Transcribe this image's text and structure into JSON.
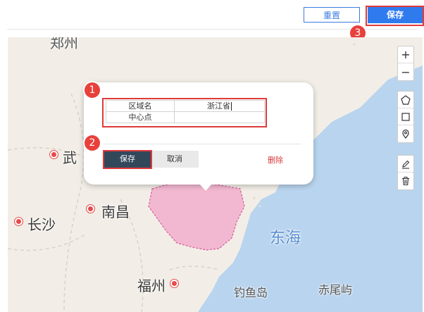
{
  "toolbar": {
    "reset_label": "重置",
    "save_label": "保存"
  },
  "map": {
    "cities": [
      {
        "name": "武",
        "dot": true
      },
      {
        "name": "长沙",
        "dot": true
      },
      {
        "name": "南昌",
        "dot": true
      },
      {
        "name": "福州",
        "dot": true
      }
    ],
    "top_city_fragment": "郑州",
    "sea_label": "东海",
    "islands": [
      "钓鱼岛",
      "赤尾屿"
    ],
    "highlighted_region_color": "#f2a6c9",
    "sea_color": "#b9d4ee",
    "land_color": "#f2eee7"
  },
  "map_controls": {
    "zoom_in": "+",
    "zoom_out": "−",
    "draw_tools": [
      "polygon-icon",
      "rectangle-icon",
      "marker-icon"
    ],
    "edit_tools": [
      "pencil-icon",
      "trash-icon"
    ]
  },
  "popup": {
    "fields": [
      {
        "label": "区域名",
        "value": "浙江省"
      },
      {
        "label": "中心点",
        "value": ""
      }
    ],
    "save_label": "保存",
    "cancel_label": "取消",
    "delete_label": "删除"
  },
  "annotations": {
    "badge1": "1",
    "badge2": "2",
    "badge3": "3",
    "highlight_color": "#e03a3a"
  }
}
